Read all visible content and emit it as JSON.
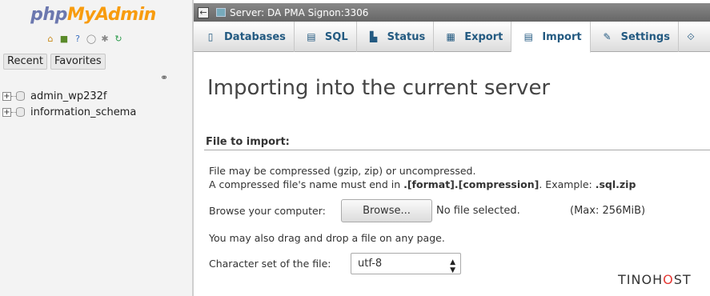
{
  "nav": {
    "logo_part1": "php",
    "logo_part2": "MyAdmin",
    "quick_icons": [
      {
        "name": "home-icon",
        "glyph": "⌂",
        "color": "#c98a1a"
      },
      {
        "name": "logout-icon",
        "glyph": "■",
        "color": "#5a8a2a"
      },
      {
        "name": "help-icon",
        "glyph": "?",
        "color": "#3a6fbf"
      },
      {
        "name": "docs-icon",
        "glyph": "◯",
        "color": "#888888"
      },
      {
        "name": "settings-icon",
        "glyph": "✱",
        "color": "#888888"
      },
      {
        "name": "reload-icon",
        "glyph": "↻",
        "color": "#2a9a4a"
      }
    ],
    "tab_recent": "Recent",
    "tab_favorites": "Favorites",
    "link_icon": "link-icon",
    "databases": [
      "admin_wp232f",
      "information_schema"
    ]
  },
  "serverbar": {
    "label": "Server: DA PMA Signon:3306"
  },
  "tabs": [
    {
      "label": "Databases",
      "icon": "databases-icon",
      "glyph": "▯",
      "active": false
    },
    {
      "label": "SQL",
      "icon": "sql-icon",
      "glyph": "▤",
      "active": false
    },
    {
      "label": "Status",
      "icon": "status-icon",
      "glyph": "▙",
      "active": false
    },
    {
      "label": "Export",
      "icon": "export-icon",
      "glyph": "▦",
      "active": false
    },
    {
      "label": "Import",
      "icon": "import-icon",
      "glyph": "▤",
      "active": true
    },
    {
      "label": "Settings",
      "icon": "settings-icon",
      "glyph": "✎",
      "active": false
    }
  ],
  "main": {
    "title": "Importing into the current server",
    "legend": "File to import:",
    "compressed_note": "File may be compressed (gzip, zip) or uncompressed.",
    "name_note_prefix": "A compressed file's name must end in ",
    "name_note_format": ".[format].[compression]",
    "name_note_middle": ". Example: ",
    "name_note_example": ".sql.zip",
    "browse_label": "Browse your computer:",
    "browse_button": "Browse...",
    "no_file": "No file selected.",
    "max_size": "(Max: 256MiB)",
    "drag_note": "You may also drag and drop a file on any page.",
    "charset_label": "Character set of the file:",
    "charset_value": "utf-8"
  },
  "watermark": {
    "part1": "TINO",
    "part2": "H",
    "part3": "O",
    "part4": "ST"
  },
  "colors": {
    "tab_text": "#235a81",
    "logo_php": "#6c78af",
    "logo_myadmin": "#f89c0e"
  }
}
